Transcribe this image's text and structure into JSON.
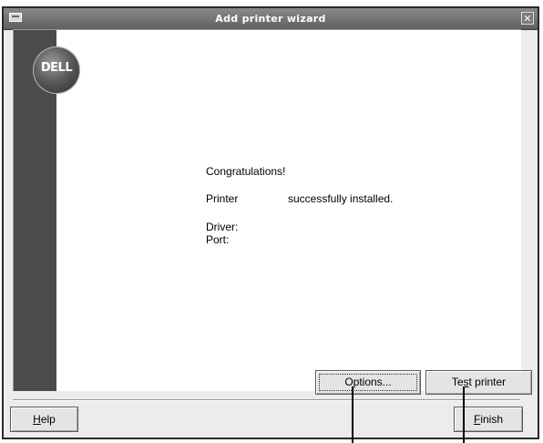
{
  "window": {
    "title": "Add printer wizard",
    "close_glyph": "✕",
    "window_menu_icon": "window-menu-icon",
    "close_icon": "close-icon"
  },
  "logo": {
    "text": "DELL"
  },
  "content": {
    "congratulations": "Congratulations!",
    "printer_label": "Printer",
    "printer_status": "successfully installed.",
    "driver_label": "Driver:",
    "port_label": "Port:"
  },
  "buttons": {
    "options": "Options...",
    "test_printer_prefix": "Te",
    "test_printer_accel": "s",
    "test_printer_suffix": "t printer",
    "help_accel": "H",
    "help_rest": "elp",
    "finish_accel": "F",
    "finish_rest": "inish"
  },
  "colors": {
    "titlebar": "#6f6f6f",
    "side_strip": "#4b4b4b",
    "window_bg": "#ececec"
  }
}
